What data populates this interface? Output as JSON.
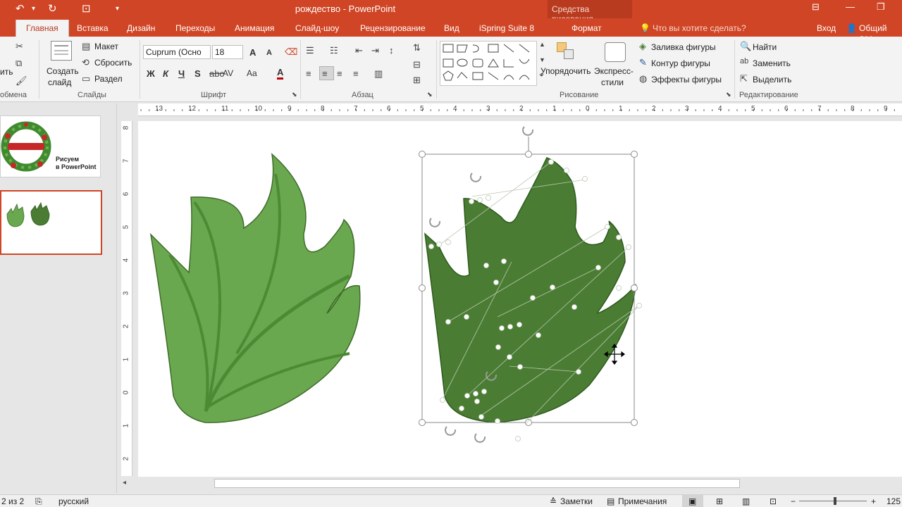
{
  "titlebar": {
    "title": "рождество - PowerPoint",
    "contextual_group": "Средства рисования"
  },
  "tabs": [
    {
      "label": "Главная",
      "active": true
    },
    {
      "label": "Вставка"
    },
    {
      "label": "Дизайн"
    },
    {
      "label": "Переходы"
    },
    {
      "label": "Анимация"
    },
    {
      "label": "Слайд-шоу"
    },
    {
      "label": "Рецензирование"
    },
    {
      "label": "Вид"
    },
    {
      "label": "iSpring Suite 8"
    },
    {
      "label": "Формат"
    }
  ],
  "tell_me": "Что вы хотите сделать?",
  "signin": "Вход",
  "share": "Общий дос",
  "ribbon": {
    "clipboard": {
      "paste_partial": "ить",
      "label": "обмена"
    },
    "slides": {
      "new_slide": "Создать",
      "new_slide2": "слайд",
      "layout": "Макет",
      "reset": "Сбросить",
      "section": "Раздел",
      "label": "Слайды"
    },
    "font": {
      "name": "Cuprum (Осно",
      "size": "18",
      "bold": "Ж",
      "italic": "К",
      "underline": "Ч",
      "strike": "S",
      "spacing": "AV",
      "case": "Aa",
      "grow": "A",
      "shrink": "A",
      "color": "A",
      "label": "Шрифт"
    },
    "paragraph": {
      "label": "Абзац"
    },
    "drawing": {
      "arrange": "Упорядочить",
      "quick_styles": "Экспресс-",
      "quick_styles2": "стили",
      "fill": "Заливка фигуры",
      "outline": "Контур фигуры",
      "effects": "Эффекты фигуры",
      "label": "Рисование"
    },
    "editing": {
      "find": "Найти",
      "replace": "Заменить",
      "select": "Выделить",
      "label": "Редактирование"
    }
  },
  "ruler_h_ticks": [
    "13",
    "12",
    "11",
    "10",
    "9",
    "8",
    "7",
    "6",
    "5",
    "4",
    "3",
    "2",
    "1",
    "0",
    "1",
    "2",
    "3",
    "4",
    "5",
    "6",
    "7",
    "8",
    "9"
  ],
  "ruler_v_ticks": [
    "8",
    "7",
    "6",
    "5",
    "4",
    "3",
    "2",
    "1",
    "0",
    "1",
    "2"
  ],
  "thumbnails": [
    {
      "number": "",
      "caption1": "Рисуем",
      "caption2": "в PowerPoint"
    },
    {
      "number": "",
      "selected": true
    }
  ],
  "status": {
    "slide_of": "2 из 2",
    "language": "русский",
    "notes": "Заметки",
    "comments": "Примечания",
    "zoom": "125"
  },
  "colors": {
    "accent": "#d04525",
    "leaf_light": "#6aa84f",
    "leaf_dark": "#4a7d33"
  }
}
